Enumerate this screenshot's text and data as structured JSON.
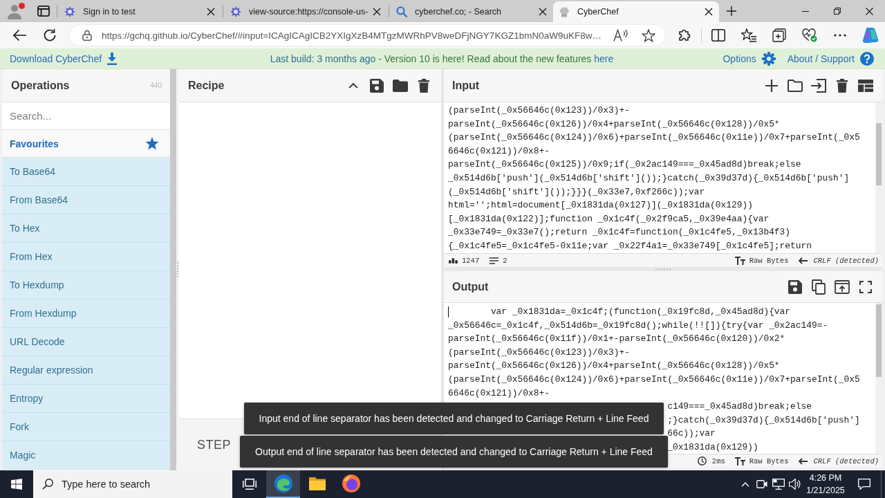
{
  "browser": {
    "tabs": [
      {
        "kind": "badge",
        "title": "Sign in to test",
        "selected": false
      },
      {
        "kind": "badge",
        "title": "view-source:https://console-us-",
        "selected": false
      },
      {
        "kind": "search",
        "title": "cyberchef.co; - Search",
        "selected": false
      },
      {
        "kind": "chef",
        "title": "CyberChef",
        "selected": true
      }
    ],
    "address": {
      "url": "https://gchq.github.io/CyberChef/#input=ICAgICAgICB2YXIgXzB4MTgzMWRhPV8weDFjNGY7KGZ1bmN0aW9uKF8w…"
    }
  },
  "banner": {
    "download": "Download CyberChef",
    "notice": {
      "build": "Last build: 3 months ago",
      "text": "- Version 10 is here! Read about the new features",
      "link": "here"
    },
    "options": "Options",
    "about": "About / Support"
  },
  "operations": {
    "title": "Operations",
    "count": "440",
    "search": {
      "placeholder": "Search..."
    },
    "favourites": "Favourites",
    "items": [
      "To Base64",
      "From Base64",
      "To Hex",
      "From Hex",
      "To Hexdump",
      "From Hexdump",
      "URL Decode",
      "Regular expression",
      "Entropy",
      "Fork",
      "Magic"
    ]
  },
  "recipe": {
    "title": "Recipe",
    "step": "STEP"
  },
  "input": {
    "title": "Input",
    "lines": [
      "(parseInt(_0x56646c(0x123))/0x3)+-",
      "parseInt(_0x56646c(0x126))/0x4+parseInt(_0x56646c(0x128))/0x5*",
      "(parseInt(_0x56646c(0x124))/0x6)+parseInt(_0x56646c(0x11e))/0x7+parseInt(_0x5",
      "6646c(0x121))/0x8+-",
      "parseInt(_0x56646c(0x125))/0x9;if(_0x2ac149===_0x45ad8d)break;else",
      "_0x514d6b['push'](_0x514d6b['shift']());}catch(_0x39d37d){_0x514d6b['push']",
      "(_0x514d6b['shift']());}}}(_0x33e7,0xf266c));var",
      "html='';html=document[_0x1831da(0x127)](_0x1831da(0x129))",
      "[_0x1831da(0x122)];function _0x1c4f(_0x2f9ca5,_0x39e4aa){var",
      "_0x33e749=_0x33e7();return _0x1c4f=function(_0x1c4fe5,_0x13b4f3)",
      "{_0x1c4fe5=_0x1c4fe5-0x11e;var _0x22f4a1=_0x33e749[_0x1c4fe5];return"
    ],
    "status": {
      "length": "1247",
      "lines": "2",
      "format": "Raw Bytes",
      "eol": "CRLF (detected)"
    }
  },
  "output": {
    "title": "Output",
    "lines": [
      {
        "kind": "indented",
        "text": "var _0x1831da=_0x1c4f;(function(_0x19fc8d,_0x45ad8d){var"
      },
      {
        "kind": "plain",
        "text": "_0x56646c=_0x1c4f,_0x514d6b=_0x19fc8d();while(!![]){try{var _0x2ac149=-"
      },
      {
        "kind": "plain",
        "text": "parseInt(_0x56646c(0x11f))/0x1+-parseInt(_0x56646c(0x120))/0x2*"
      },
      {
        "kind": "plain",
        "text": "(parseInt(_0x56646c(0x123))/0x3)+-"
      },
      {
        "kind": "plain",
        "text": "parseInt(_0x56646c(0x126))/0x4+parseInt(_0x56646c(0x128))/0x5*"
      },
      {
        "kind": "plain",
        "text": "(parseInt(_0x56646c(0x124))/0x6)+parseInt(_0x56646c(0x11e))/0x7+parseInt(_0x5"
      },
      {
        "kind": "plain",
        "text": "6646c(0x121))/0x8+-"
      },
      {
        "kind": "partial",
        "text": "c149===_0x45ad8d)break;else"
      },
      {
        "kind": "partial",
        "text": ";}catch(_0x39d37d){_0x514d6b['push']"
      },
      {
        "kind": "partial",
        "text": "66c));var"
      },
      {
        "kind": "partial",
        "text": "_0x1831da(0x129))"
      }
    ],
    "status": {
      "time": "2ms",
      "format": "Raw Bytes",
      "eol": "CRLF (detected)"
    }
  },
  "toasts": [
    "Input end of line separator has been detected and changed to Carriage Return + Line Feed",
    "Output end of line separator has been detected and changed to Carriage Return + Line Feed"
  ],
  "taskbar": {
    "search": {
      "placeholder": "Type here to search"
    },
    "apps": [
      {
        "kind": "browser",
        "selected": true
      },
      {
        "kind": "files",
        "selected": false
      },
      {
        "kind": "fox",
        "selected": false
      }
    ],
    "time": "4:26 PM",
    "date": "1/21/2025"
  }
}
